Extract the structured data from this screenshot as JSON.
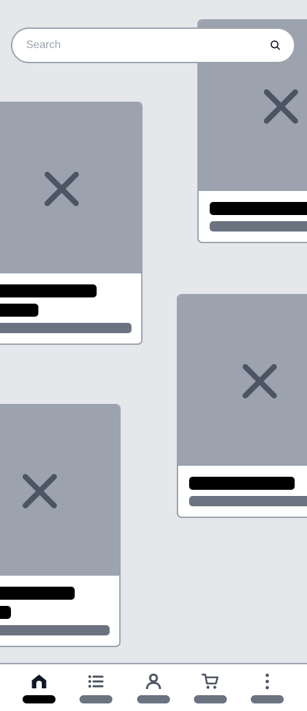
{
  "search": {
    "placeholder": "Search",
    "value": ""
  },
  "product_cards": [
    {
      "image_icon": "broken-image-x-icon",
      "title_lines": 1,
      "has_subtitle": true
    },
    {
      "image_icon": "broken-image-x-icon",
      "title_lines": 2,
      "has_subtitle": true
    },
    {
      "image_icon": "broken-image-x-icon",
      "title_lines": 1,
      "has_subtitle": true
    },
    {
      "image_icon": "broken-image-x-icon",
      "title_lines": 2,
      "has_subtitle": true
    }
  ],
  "bottom_nav": {
    "items": [
      {
        "icon": "home-icon",
        "active": true
      },
      {
        "icon": "list-icon",
        "active": false
      },
      {
        "icon": "profile-icon",
        "active": false
      },
      {
        "icon": "cart-icon",
        "active": false
      },
      {
        "icon": "more-vertical-icon",
        "active": false
      }
    ]
  },
  "colors": {
    "background": "#e5e7eb",
    "placeholder_image": "#9ca3af",
    "icon": "#4b5563",
    "skeleton_dark": "#000000",
    "skeleton_muted": "#6b7280",
    "border": "#9ca3af"
  }
}
